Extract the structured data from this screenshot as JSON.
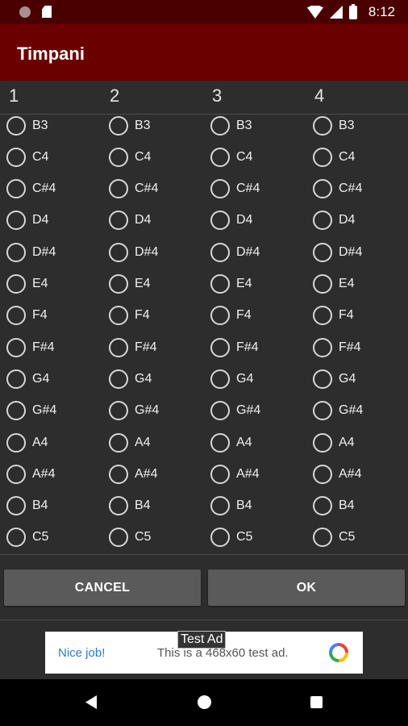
{
  "status_bar": {
    "time": "8:12",
    "icons": [
      "notification-dot-icon",
      "sd-card-icon",
      "wifi-icon",
      "signal-icon",
      "battery-icon"
    ]
  },
  "app_bar": {
    "title": "Timpani"
  },
  "columns": [
    {
      "label": "1"
    },
    {
      "label": "2"
    },
    {
      "label": "3"
    },
    {
      "label": "4"
    }
  ],
  "notes": [
    "B3",
    "C4",
    "C#4",
    "D4",
    "D#4",
    "E4",
    "F4",
    "F#4",
    "G4",
    "G#4",
    "A4",
    "A#4",
    "B4",
    "C5"
  ],
  "buttons": {
    "cancel": "CANCEL",
    "ok": "OK"
  },
  "ad": {
    "tag": "Test Ad",
    "nice": "Nice job!",
    "text": "This is a 468x60 test ad."
  },
  "colors": {
    "status_bar": "#4a0000",
    "app_bar": "#6b0000",
    "background": "#2d2d2d",
    "button": "#5a5a5a"
  }
}
